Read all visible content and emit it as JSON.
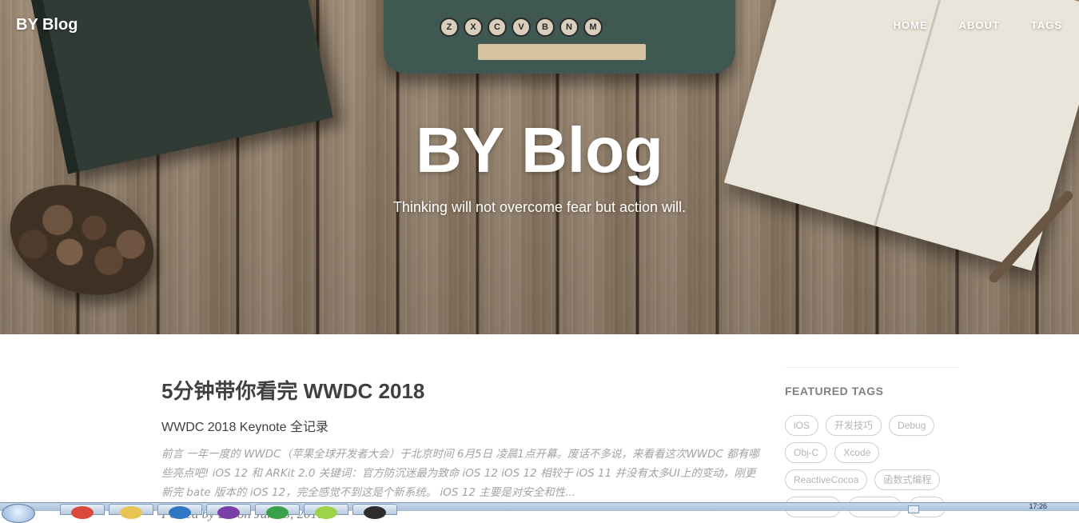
{
  "site": {
    "brand": "BY Blog",
    "nav": [
      "HOME",
      "ABOUT",
      "TAGS"
    ],
    "hero_title": "BY Blog",
    "hero_subtitle": "Thinking will not overcome fear but action will."
  },
  "hero_image": {
    "typewriter_keys": [
      "Z",
      "X",
      "C",
      "V",
      "B",
      "N",
      "M"
    ]
  },
  "post": {
    "title": "5分钟带你看完 WWDC 2018",
    "subtitle": "WWDC 2018 Keynote 全记录",
    "excerpt": "前言 一年一度的 WWDC（苹果全球开发者大会）于北京时间 6月5日 凌晨1点开幕。废话不多说，来看看这次WWDC 都有哪些亮点吧! iOS 12 和 ARKit 2.0 关键词：官方防沉迷最为致命 iOS 12 iOS 12 相较于 iOS 11 并没有太多UI上的变动，刚更新完 bate 版本的 iOS 12，完全感觉不到这是个新系统。 iOS 12 主要是对安全和性...",
    "meta": "Posted by BY on June 5, 2018"
  },
  "sidebar": {
    "heading": "FEATURED TAGS",
    "tags": [
      "iOS",
      "开发技巧",
      "Debug",
      "Obj-C",
      "Xcode",
      "ReactiveCocoa",
      "函数式编程",
      "开源框架",
      "Runtime",
      "生活"
    ]
  },
  "taskbar": {
    "clock": "17:26"
  },
  "colors": {
    "text_dark": "#404040",
    "text_muted": "#a3a3a3",
    "tag_border": "#cfcfcf"
  }
}
